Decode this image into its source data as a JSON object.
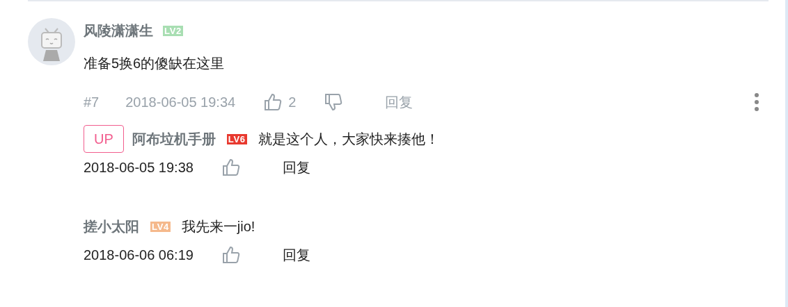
{
  "comment": {
    "username": "风陵潇潇生",
    "level": {
      "label": "LV2",
      "color": "#a8deb2"
    },
    "content": "准备5换6的傻缺在这里",
    "floor": "#7",
    "time": "2018-06-05 19:34",
    "likes": "2",
    "reply_label": "回复"
  },
  "replies": [
    {
      "badge": "UP",
      "username": "阿布垃机手册",
      "level": {
        "label": "LV6",
        "color": "#e8392f"
      },
      "content": "就是这个人，大家快来揍他！",
      "time": "2018-06-05 19:38",
      "reply_label": "回复"
    },
    {
      "username": "搓小太阳",
      "level": {
        "label": "LV4",
        "color": "#f5b98c"
      },
      "content": "我先来一jio!",
      "time": "2018-06-06 06:19",
      "reply_label": "回复"
    }
  ]
}
